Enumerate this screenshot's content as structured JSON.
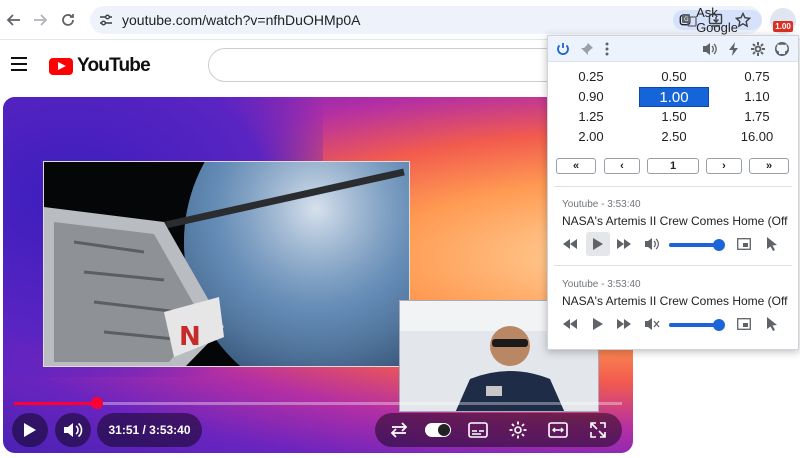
{
  "browser": {
    "url": "youtube.com/watch?v=nfhDuOHMp0A",
    "ask_google": "Ask Google",
    "extension_badge": "1.00",
    "accent": "#1a73e8"
  },
  "youtube": {
    "logo": "YouTube",
    "search_placeholder": ""
  },
  "player": {
    "time_display": "31:51 / 3:53:40",
    "progress": 0.136,
    "brand_red": "#ff0033"
  },
  "popup": {
    "speeds": [
      [
        "0.25",
        "0.50",
        "0.75"
      ],
      [
        "0.90",
        "1.00",
        "1.10"
      ],
      [
        "1.25",
        "1.50",
        "1.75"
      ],
      [
        "2.00",
        "2.50",
        "16.00"
      ]
    ],
    "active_speed": "1.00",
    "pager": {
      "first": "«",
      "prev": "‹",
      "page": "1",
      "next": "›",
      "last": "»"
    },
    "media": [
      {
        "source": "Youtube - 3:53:40",
        "title": "NASA's Artemis II Crew Comes Home (Off",
        "volume": 0.95,
        "muted": false,
        "play_highlight": true
      },
      {
        "source": "Youtube - 3:53:40",
        "title": "NASA's Artemis II Crew Comes Home (Off",
        "volume": 0.95,
        "muted": true,
        "play_highlight": false
      }
    ]
  }
}
